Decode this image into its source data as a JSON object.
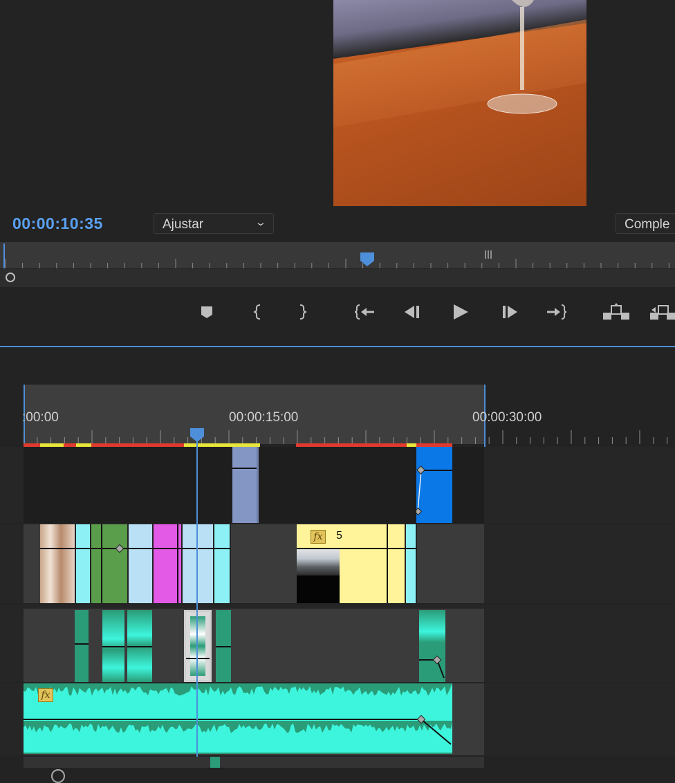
{
  "monitor": {
    "timecode": "00:00:10:35",
    "fit_dropdown": "Ajustar",
    "quality_dropdown": "Comple",
    "transport_icons": [
      "add-marker",
      "mark-in",
      "mark-out",
      "go-to-in",
      "step-back",
      "play",
      "step-forward",
      "go-to-out",
      "lift",
      "extract"
    ]
  },
  "timeline": {
    "ruler_labels": [
      ":00:00",
      "00:00:15:00",
      "00:00:30:00"
    ],
    "nested_clip_number": "5"
  },
  "colors": {
    "accent": "#4d8fd9",
    "timecode": "#5aa0f0",
    "clip_cyan": "#8df0f5",
    "clip_green": "#5a9d4a",
    "clip_magenta": "#e35ae6",
    "clip_light_blue": "#b9e0f5",
    "clip_yellow": "#fff49a",
    "clip_slate": "#8496c4",
    "clip_blue": "#0a78e6",
    "audio_green": "#2a9c78",
    "audio_cyan": "#3df5dc",
    "fx_badge": "#e2c25a"
  }
}
